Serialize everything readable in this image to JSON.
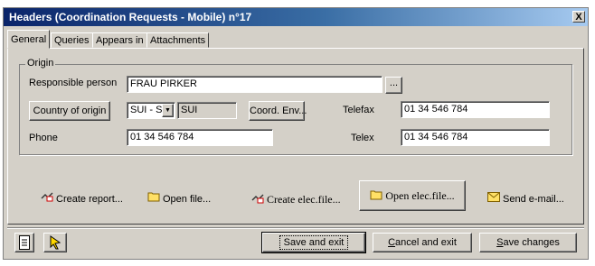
{
  "window": {
    "title": "Headers (Coordination Requests - Mobile) n°17",
    "close_label": "X"
  },
  "tabs": [
    {
      "label": "General",
      "active": true
    },
    {
      "label": "Queries",
      "active": false
    },
    {
      "label": "Appears in",
      "active": false
    },
    {
      "label": "Attachments",
      "active": false
    }
  ],
  "origin": {
    "group_label": "Origin",
    "responsible_label": "Responsible person",
    "responsible_value": "FRAU PIRKER",
    "browse_label": "...",
    "country_button": "Country of origin",
    "country_code": "SUI - S",
    "country_name": "SUI",
    "coord_env_button": "Coord. Env...",
    "telefax_label": "Telefax",
    "telefax_value": "01 34 546 784",
    "phone_label": "Phone",
    "phone_value": "01 34 546 784",
    "telex_label": "Telex",
    "telex_value": "01 34 546 784"
  },
  "actions": {
    "create_report": "Create report...",
    "open_file": "Open file...",
    "create_elec_file": "Create elec.file...",
    "open_elec_file": "Open elec.file...",
    "send_email": "Send e-mail..."
  },
  "footer": {
    "save_exit": "Save and exit",
    "cancel_exit_u": "C",
    "cancel_exit_rest": "ancel and exit",
    "save_changes_u": "S",
    "save_changes_rest": "ave changes"
  },
  "colors": {
    "title_bar": "#0a246a",
    "face": "#d4d0c8",
    "folder": "#ffe066",
    "pointer": "#ffd800"
  }
}
